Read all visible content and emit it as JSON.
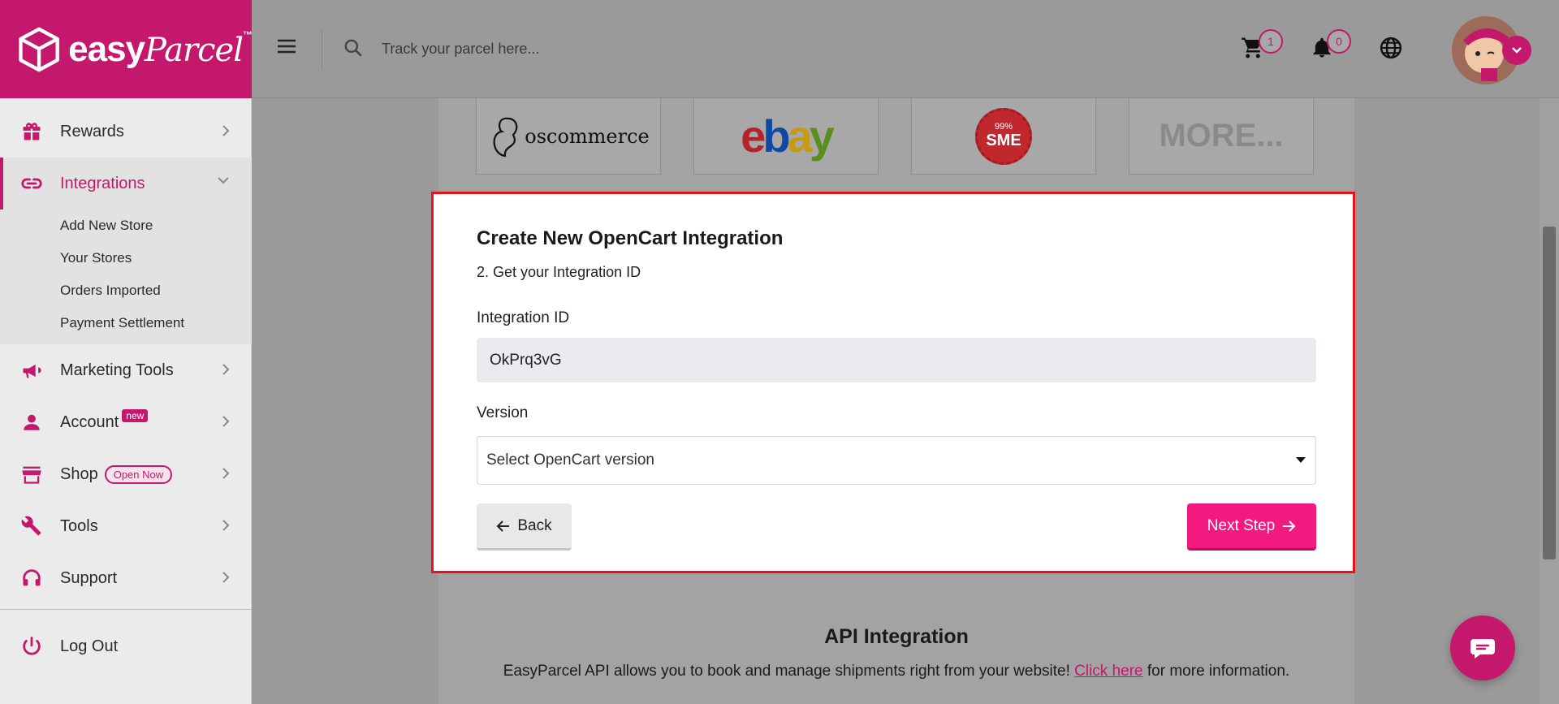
{
  "brand": {
    "logo_main": "easy",
    "logo_accent": "Parcel",
    "logo_tm": "™"
  },
  "header": {
    "search_placeholder": "Track your parcel here...",
    "cart_count": "1",
    "notification_count": "0"
  },
  "sidebar": {
    "items": [
      {
        "label": "Rewards"
      },
      {
        "label": "Integrations"
      },
      {
        "label": "Marketing Tools"
      },
      {
        "label": "Account",
        "badge": "new"
      },
      {
        "label": "Shop",
        "badge": "Open Now"
      },
      {
        "label": "Tools"
      },
      {
        "label": "Support"
      }
    ],
    "sub_items": [
      "Add New Store",
      "Your Stores",
      "Orders Imported",
      "Payment Settlement"
    ],
    "logout_label": "Log Out"
  },
  "platforms": {
    "oscommerce": "oscommerce",
    "ebay": [
      "e",
      "b",
      "a",
      "y"
    ],
    "sme_top": "99%",
    "sme_main": "SME",
    "more": "MORE..."
  },
  "modal": {
    "title": "Create New OpenCart Integration",
    "step": "2. Get your Integration ID",
    "id_label": "Integration ID",
    "id_value": "OkPrq3vG",
    "version_label": "Version",
    "version_selected": "Select OpenCart version",
    "back_label": "Back",
    "next_label": "Next Step"
  },
  "api": {
    "title": "API Integration",
    "text_before": "EasyParcel API allows you to book and manage shipments right from your website!",
    "link_text": "Click here",
    "text_after": "for more information."
  },
  "colors": {
    "brand": "#c3186c",
    "primary_button": "#f2197f",
    "highlight_border": "#e3151b"
  }
}
